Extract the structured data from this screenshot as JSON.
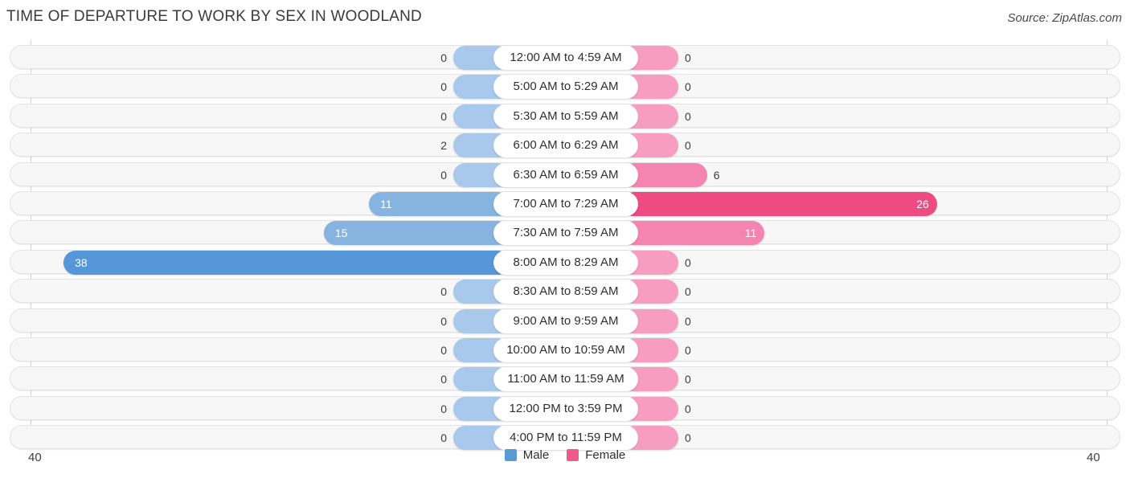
{
  "header": {
    "title": "TIME OF DEPARTURE TO WORK BY SEX IN WOODLAND",
    "source": "Source: ZipAtlas.com"
  },
  "axis": {
    "left_label": "40",
    "right_label": "40",
    "max": 40
  },
  "legend": {
    "items": [
      {
        "label": "Male",
        "color": "#5B9BD5"
      },
      {
        "label": "Female",
        "color": "#ED5A8B"
      }
    ]
  },
  "colors": {
    "male_light": "#A8C8EC",
    "male_mid": "#87B3E0",
    "male_dark": "#5596D8",
    "female_light": "#F79DC0",
    "female_mid": "#F385B0",
    "female_dark": "#ED4B82",
    "track_bg": "#F7F7F7",
    "track_border": "#E3E3E3"
  },
  "chart_data": {
    "type": "bar",
    "title": "TIME OF DEPARTURE TO WORK BY SEX IN WOODLAND",
    "xlabel": "",
    "ylabel": "",
    "orientation": "horizontal-diverging",
    "xlim": [
      40,
      40
    ],
    "grid": false,
    "legend_position": "bottom-center",
    "categories": [
      "12:00 AM to 4:59 AM",
      "5:00 AM to 5:29 AM",
      "5:30 AM to 5:59 AM",
      "6:00 AM to 6:29 AM",
      "6:30 AM to 6:59 AM",
      "7:00 AM to 7:29 AM",
      "7:30 AM to 7:59 AM",
      "8:00 AM to 8:29 AM",
      "8:30 AM to 8:59 AM",
      "9:00 AM to 9:59 AM",
      "10:00 AM to 10:59 AM",
      "11:00 AM to 11:59 AM",
      "12:00 PM to 3:59 PM",
      "4:00 PM to 11:59 PM"
    ],
    "series": [
      {
        "name": "Male",
        "values": [
          0,
          0,
          0,
          2,
          0,
          11,
          15,
          38,
          0,
          0,
          0,
          0,
          0,
          0
        ]
      },
      {
        "name": "Female",
        "values": [
          0,
          0,
          0,
          0,
          6,
          26,
          11,
          0,
          0,
          0,
          0,
          0,
          0,
          0
        ]
      }
    ]
  },
  "rows": [
    {
      "label": "12:00 AM to 4:59 AM",
      "male": "0",
      "female": "0"
    },
    {
      "label": "5:00 AM to 5:29 AM",
      "male": "0",
      "female": "0"
    },
    {
      "label": "5:30 AM to 5:59 AM",
      "male": "0",
      "female": "0"
    },
    {
      "label": "6:00 AM to 6:29 AM",
      "male": "2",
      "female": "0"
    },
    {
      "label": "6:30 AM to 6:59 AM",
      "male": "0",
      "female": "6"
    },
    {
      "label": "7:00 AM to 7:29 AM",
      "male": "11",
      "female": "26"
    },
    {
      "label": "7:30 AM to 7:59 AM",
      "male": "15",
      "female": "11"
    },
    {
      "label": "8:00 AM to 8:29 AM",
      "male": "38",
      "female": "0"
    },
    {
      "label": "8:30 AM to 8:59 AM",
      "male": "0",
      "female": "0"
    },
    {
      "label": "9:00 AM to 9:59 AM",
      "male": "0",
      "female": "0"
    },
    {
      "label": "10:00 AM to 10:59 AM",
      "male": "0",
      "female": "0"
    },
    {
      "label": "11:00 AM to 11:59 AM",
      "male": "0",
      "female": "0"
    },
    {
      "label": "12:00 PM to 3:59 PM",
      "male": "0",
      "female": "0"
    },
    {
      "label": "4:00 PM to 11:59 PM",
      "male": "0",
      "female": "0"
    }
  ]
}
